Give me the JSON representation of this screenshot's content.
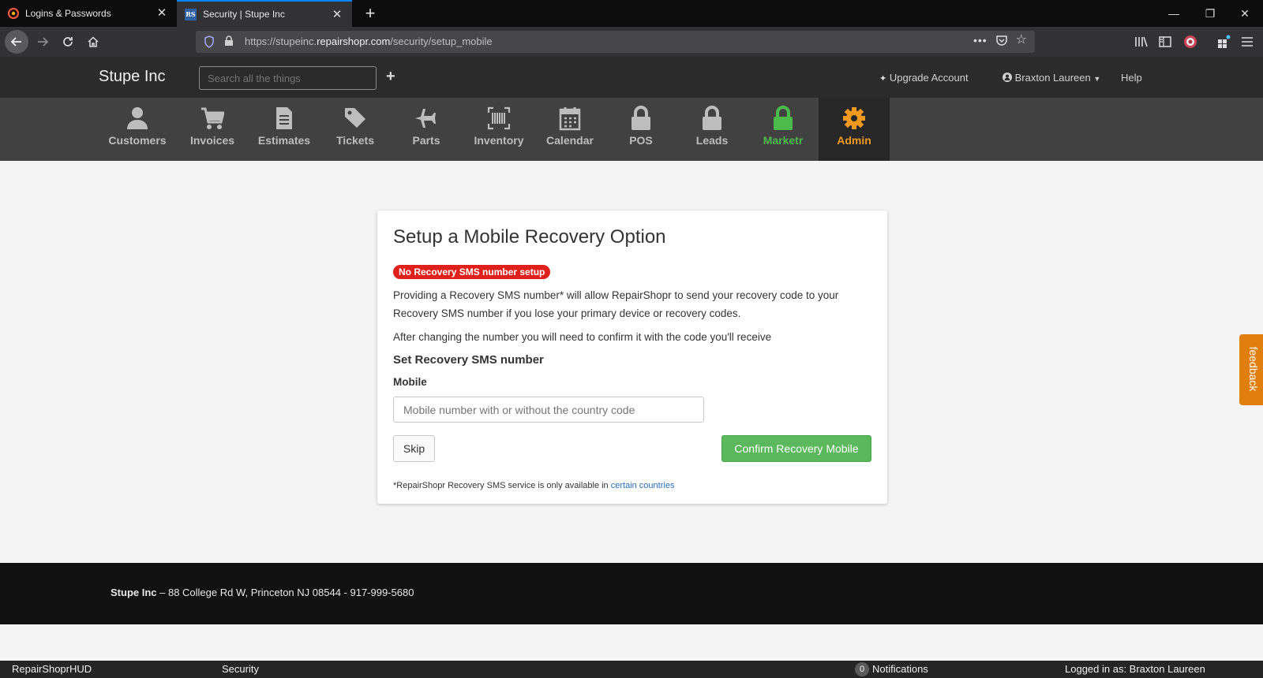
{
  "browser": {
    "tabs": [
      {
        "title": "Logins & Passwords",
        "active": false
      },
      {
        "title": "Security | Stupe Inc",
        "active": true
      }
    ],
    "url_prefix": "https://stupeinc.",
    "url_domain": "repairshopr.com",
    "url_path": "/security/setup_mobile",
    "favicon_text": "RS"
  },
  "header": {
    "brand": "Stupe Inc",
    "search_placeholder": "Search all the things",
    "add_symbol": "+",
    "upgrade_label": "Upgrade Account",
    "user_label": "Braxton Laureen",
    "help_label": "Help"
  },
  "modules": [
    {
      "label": "Customers",
      "icon": "user-icon"
    },
    {
      "label": "Invoices",
      "icon": "cart-icon"
    },
    {
      "label": "Estimates",
      "icon": "document-icon"
    },
    {
      "label": "Tickets",
      "icon": "tag-icon"
    },
    {
      "label": "Parts",
      "icon": "plane-icon"
    },
    {
      "label": "Inventory",
      "icon": "barcode-icon"
    },
    {
      "label": "Calendar",
      "icon": "calendar-icon"
    },
    {
      "label": "POS",
      "icon": "lock-icon"
    },
    {
      "label": "Leads",
      "icon": "lock-icon"
    },
    {
      "label": "Marketr",
      "icon": "lock-icon"
    },
    {
      "label": "Admin",
      "icon": "gear-icon"
    }
  ],
  "card": {
    "title": "Setup a Mobile Recovery Option",
    "status_badge": "No Recovery SMS number setup",
    "paragraph1": "Providing a Recovery SMS number* will allow RepairShopr to send your recovery code to your Recovery SMS number if you lose your primary device or recovery codes.",
    "paragraph2": "After changing the number you will need to confirm it with the code you'll receive",
    "section_heading": "Set Recovery SMS number",
    "field_label": "Mobile",
    "field_placeholder": "Mobile number with or without the country code",
    "skip_label": "Skip",
    "confirm_label": "Confirm Recovery Mobile",
    "note_text": "*RepairShopr Recovery SMS service is only available in ",
    "note_link": "certain countries"
  },
  "feedback_label": "feedback",
  "footer": {
    "company": "Stupe Inc",
    "address": " – 88 College Rd W, Princeton NJ 08544 - 917-999-5680"
  },
  "hud": {
    "app": "RepairShoprHUD",
    "section": "Security",
    "notif_count": "0",
    "notif_label": "Notifications",
    "logged_in": "Logged in as: Braxton Laureen"
  },
  "colors": {
    "accent_admin": "#f39a1e",
    "accent_marketr": "#4cbb4c",
    "badge_red": "#e0201b",
    "confirm_green": "#5cb85c",
    "feedback_orange": "#e07f0e"
  }
}
